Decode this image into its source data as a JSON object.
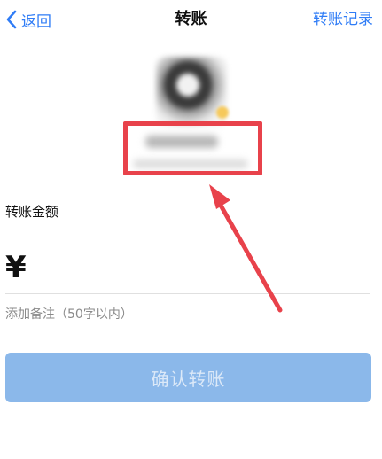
{
  "navbar": {
    "back_label": "返回",
    "title": "转账",
    "right_label": "转账记录"
  },
  "form": {
    "amount_label": "转账金额",
    "currency_symbol": "¥",
    "amount_value": "",
    "remark_label": "添加备注（50字以内）",
    "confirm_label": "确认转账"
  },
  "colors": {
    "accent": "#2f7cf6",
    "button_disabled": "#8bb8ea",
    "annotation_red": "#e8424b"
  },
  "icons": {
    "back": "chevron-left-icon"
  }
}
